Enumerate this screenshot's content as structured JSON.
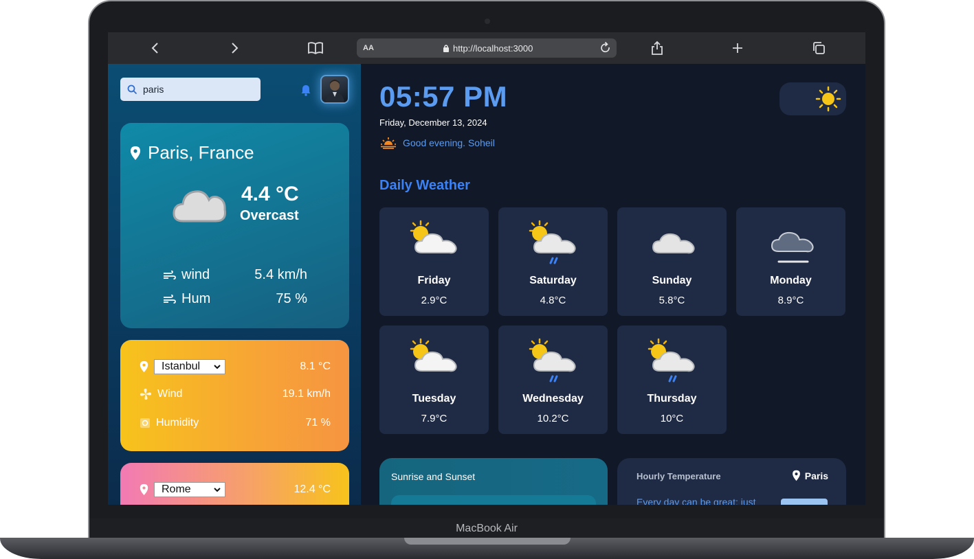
{
  "device": {
    "label": "MacBook Air"
  },
  "browser": {
    "text_size_label": "AA",
    "url": "http://localhost:3000"
  },
  "search": {
    "value": "paris"
  },
  "current": {
    "location": "Paris, France",
    "temperature": "4.4 °C",
    "condition": "Overcast",
    "wind_label": "wind",
    "wind_value": "5.4 km/h",
    "humidity_label": "Hum",
    "humidity_value": "75 %"
  },
  "cities": [
    {
      "name": "Istanbul",
      "temperature": "8.1 °C",
      "wind_label": "Wind",
      "wind_value": "19.1 km/h",
      "humidity_label": "Humidity",
      "humidity_value": "71 %"
    },
    {
      "name": "Rome",
      "temperature": "12.4 °C"
    }
  ],
  "header": {
    "time": "05:57 PM",
    "date": "Friday, December 13, 2024",
    "greeting": "Good evening. Soheil"
  },
  "daily": {
    "title": "Daily Weather",
    "days": [
      {
        "name": "Friday",
        "temp": "2.9°C",
        "icon": "partly-cloudy-icon"
      },
      {
        "name": "Saturday",
        "temp": "4.8°C",
        "icon": "partly-cloudy-rain-icon"
      },
      {
        "name": "Sunday",
        "temp": "5.8°C",
        "icon": "cloud-icon"
      },
      {
        "name": "Monday",
        "temp": "8.9°C",
        "icon": "fog-icon"
      },
      {
        "name": "Tuesday",
        "temp": "7.9°C",
        "icon": "partly-cloudy-icon"
      },
      {
        "name": "Wednesday",
        "temp": "10.2°C",
        "icon": "partly-cloudy-rain-icon"
      },
      {
        "name": "Thursday",
        "temp": "10°C",
        "icon": "partly-cloudy-rain-icon"
      }
    ]
  },
  "sun_card": {
    "title": "Sunrise and Sunset"
  },
  "hourly": {
    "title": "Hourly Temperature",
    "location": "Paris",
    "quote": "Every day can be great; just"
  },
  "colors": {
    "accent": "#5b9cf1",
    "title_blue": "#3b82f6",
    "card_bg": "#1f2a44",
    "page_bg": "#111827",
    "istanbul_gradient": [
      "#f7c31b",
      "#f69541"
    ],
    "rome_gradient": [
      "#f27ab4",
      "#f7c31b"
    ]
  }
}
